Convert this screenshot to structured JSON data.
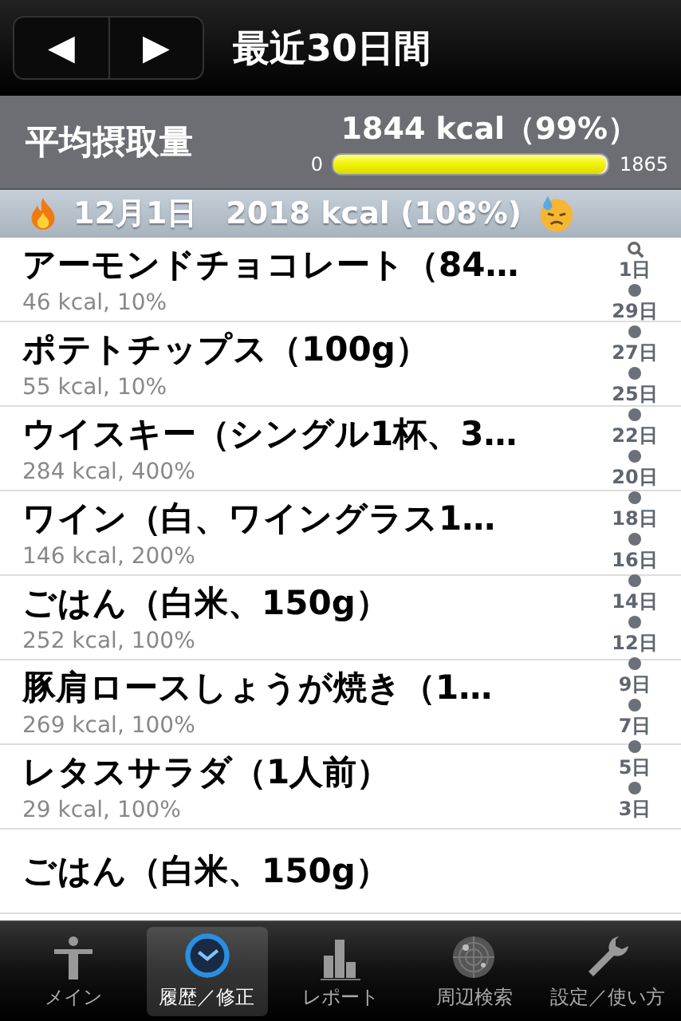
{
  "nav": {
    "prev": "◀",
    "next": "▶",
    "title": "最近30日間"
  },
  "summary": {
    "label": "平均摂取量",
    "value": "1844 kcal（99%）",
    "min": "0",
    "max": "1865",
    "level": 0.99
  },
  "section": {
    "date": "12月1日",
    "total": "2018 kcal (108%)"
  },
  "items": [
    {
      "name": "アーモンドチョコレート（84…",
      "detail": "46 kcal, 10%"
    },
    {
      "name": "ポテトチップス（100g）",
      "detail": "55 kcal, 10%"
    },
    {
      "name": "ウイスキー（シングル1杯、3…",
      "detail": "284 kcal, 400%"
    },
    {
      "name": "ワイン（白、ワイングラス1…",
      "detail": "146 kcal, 200%"
    },
    {
      "name": "ごはん（白米、150g）",
      "detail": "252 kcal, 100%"
    },
    {
      "name": "豚肩ロースしょうが焼き（1…",
      "detail": "269 kcal, 100%"
    },
    {
      "name": "レタスサラダ（1人前）",
      "detail": "29 kcal, 100%"
    },
    {
      "name": "ごはん（白米、150g）"
    }
  ],
  "index": [
    "1日",
    "29日",
    "27日",
    "25日",
    "22日",
    "20日",
    "18日",
    "16日",
    "14日",
    "12日",
    "9日",
    "7日",
    "5日",
    "3日"
  ],
  "tabs": [
    {
      "label": "メイン",
      "selected": false
    },
    {
      "label": "履歴／修正",
      "selected": true
    },
    {
      "label": "レポート",
      "selected": false
    },
    {
      "label": "周辺検索",
      "selected": false
    },
    {
      "label": "設定／使い方",
      "selected": false
    }
  ]
}
